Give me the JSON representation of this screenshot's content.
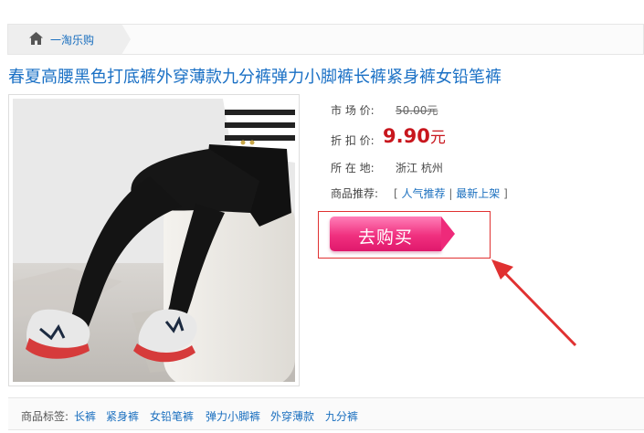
{
  "breadcrumb": {
    "home_label": "一淘乐购"
  },
  "product": {
    "title": "春夏高腰黑色打底裤外穿薄款九分裤弹力小脚裤长裤紧身裤女铅笔裤",
    "image_alt": "black leggings product photo"
  },
  "info": {
    "market_price_label": "市 场 价:",
    "market_price_value": "50.00元",
    "sale_price_label": "折 扣 价:",
    "sale_price_value": "9.90",
    "sale_price_unit": "元",
    "location_label": "所 在 地:",
    "location_value": "浙江 杭州",
    "recommend_label": "商品推荐:",
    "recommend_open": "[",
    "recommend_links": [
      "人气推荐",
      "最新上架"
    ],
    "recommend_sep": "|",
    "recommend_close": "]"
  },
  "buy": {
    "label": "去购买"
  },
  "tags": {
    "label": "商品标签:",
    "items": [
      "长裤",
      "紧身裤",
      "女铅笔裤",
      "弹力小脚裤",
      "外穿薄款",
      "九分裤"
    ]
  },
  "colors": {
    "link": "#1a6fbf",
    "price": "#c8161d",
    "buy_button": "#f0307f",
    "annotation": "#e03131"
  }
}
